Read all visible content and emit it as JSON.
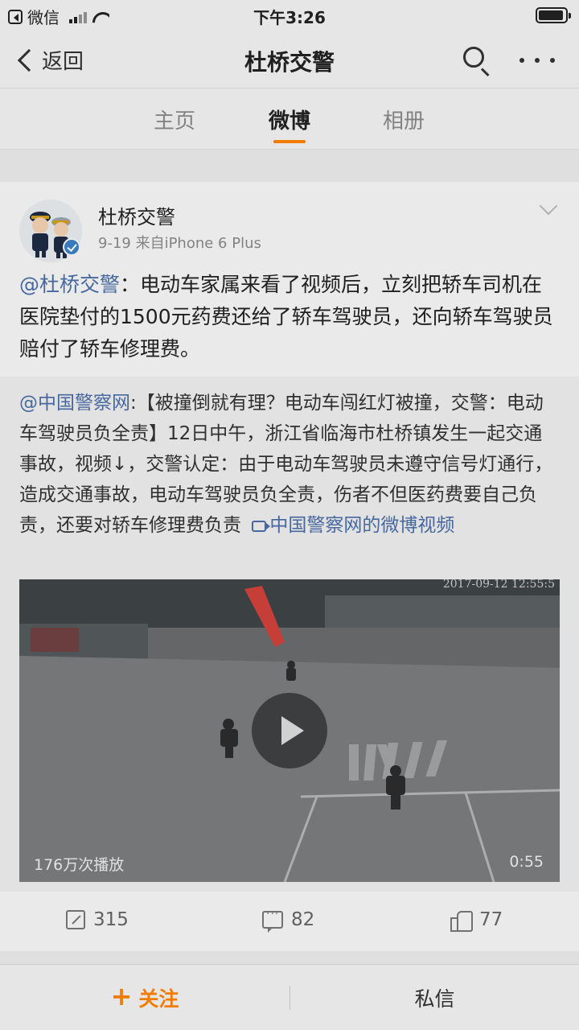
{
  "status_bar": {
    "app": "微信",
    "time": "下午3:26"
  },
  "nav": {
    "back_label": "返回",
    "title": "杜桥交警"
  },
  "tabs": [
    {
      "label": "主页",
      "active": false
    },
    {
      "label": "微博",
      "active": true
    },
    {
      "label": "相册",
      "active": false
    }
  ],
  "post": {
    "author": "杜桥交警",
    "meta": "9-19  来自iPhone 6 Plus",
    "mention": "@杜桥交警",
    "text": "：电动车家属来看了视频后，立刻把轿车司机在医院垫付的1500元药费还给了轿车驾驶员，还向轿车驾驶员赔付了轿车修理费。",
    "repost": {
      "mention": "@中国警察网",
      "text": ":【被撞倒就有理？电动车闯红灯被撞，交警：电动车驾驶员负全责】12日中午，浙江省临海市杜桥镇发生一起交通事故，视频↓，交警认定：由于电动车驾驶员未遵守信号灯通行，造成交通事故，电动车驾驶员负全责，伤者不但医药费要自己负责，还要对轿车修理费负责",
      "video_link": "中国警察网的微博视频",
      "video": {
        "timestamp": "2017-09-12 12:55:5",
        "view_count": "176万次播放",
        "duration": "0:55"
      }
    },
    "actions": {
      "reposts": "315",
      "comments": "82",
      "likes": "77"
    }
  },
  "bottom_bar": {
    "follow_label": "关注",
    "message_label": "私信"
  },
  "colors": {
    "accent": "#ff8200",
    "link": "#4a6ea8"
  }
}
